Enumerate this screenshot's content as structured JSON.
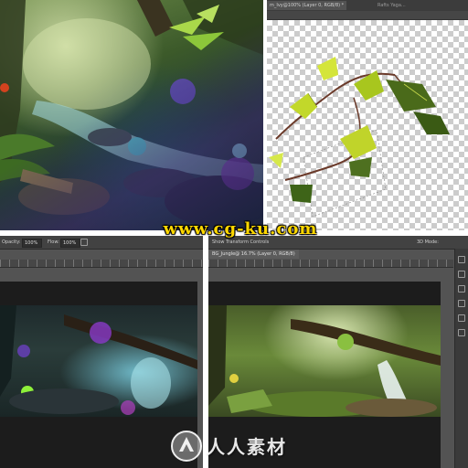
{
  "watermarks": {
    "top": "www.cg-ku.com",
    "bottom": "人人素材"
  },
  "panel_b": {
    "tab_active": "m_Ivy@100% (Layer 0, RGB/8) *",
    "tab_inactive": "Rafts Yaga..."
  },
  "panel_c": {
    "opt_opacity_label": "Opacity:",
    "opt_opacity_value": "100%",
    "opt_flow_label": "Flow:",
    "opt_flow_value": "100%"
  },
  "panel_d": {
    "opt_label": "Show Transform Controls",
    "opt_right": "3D Mode:",
    "doc_tab": "BG_Jungle@ 16.7% (Layer 0, RGB/8)"
  },
  "colors": {
    "watermark_yellow": "#ffd800",
    "ps_panel": "#535353",
    "ps_toolbar": "#424242",
    "letterbox": "#1c1c1c"
  }
}
